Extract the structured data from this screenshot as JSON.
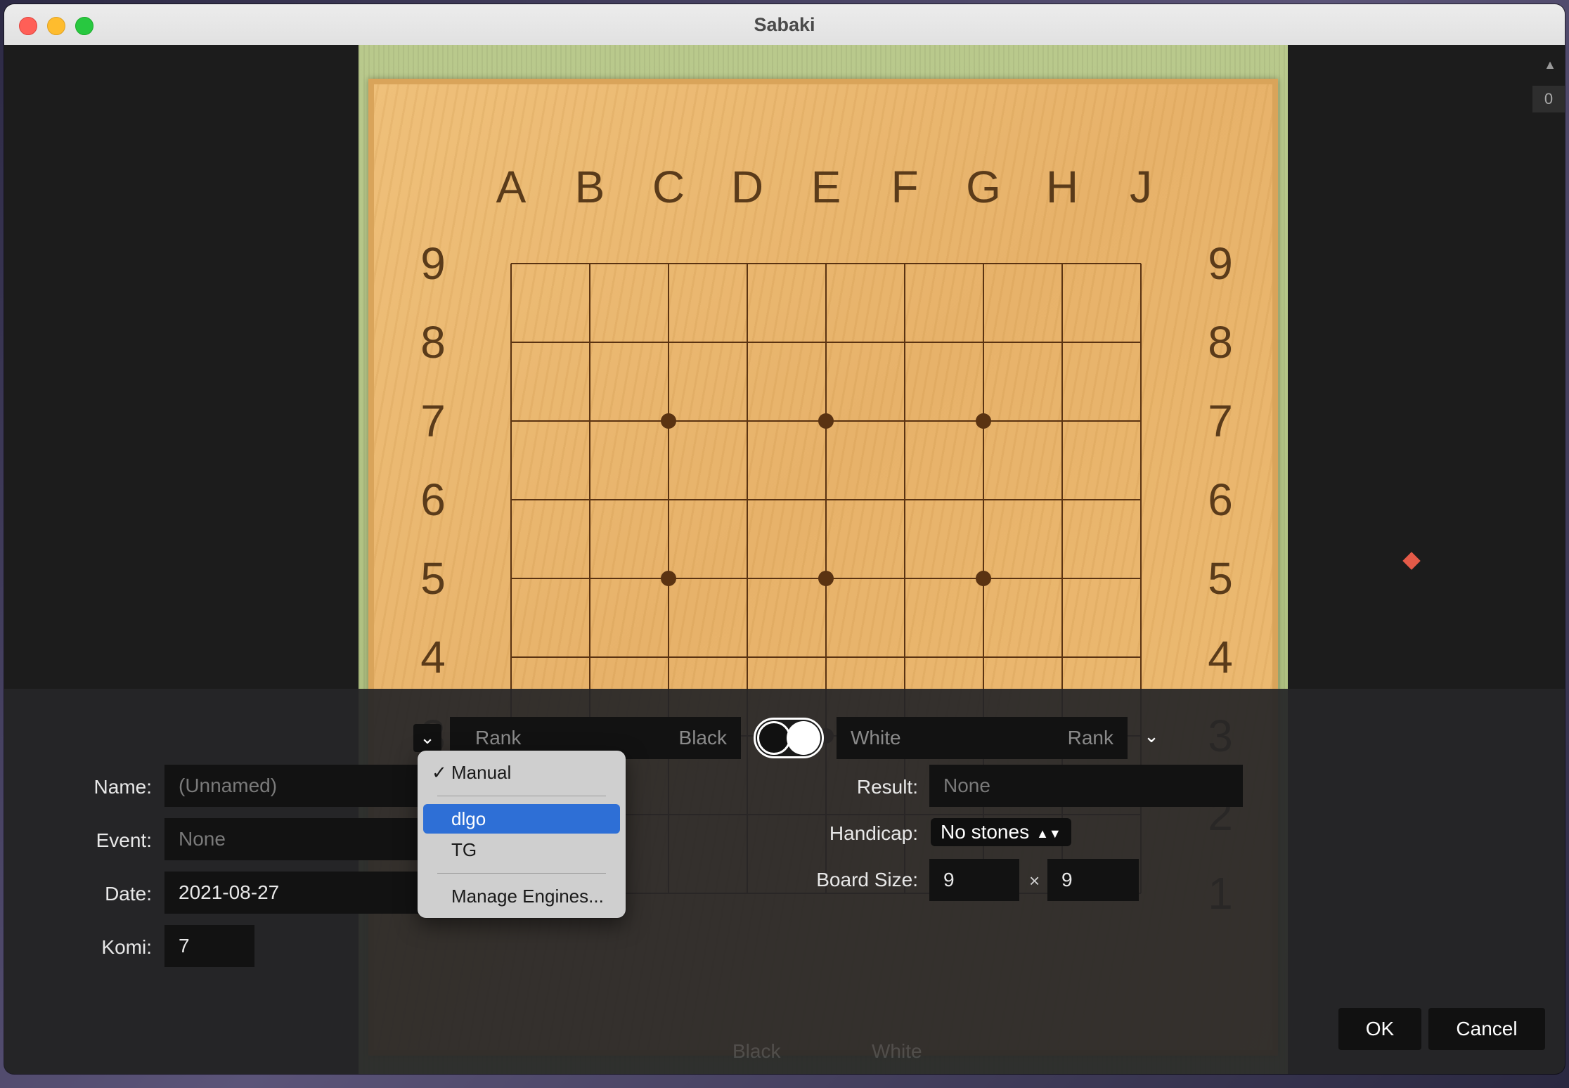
{
  "window": {
    "title": "Sabaki"
  },
  "board": {
    "columns": [
      "A",
      "B",
      "C",
      "D",
      "E",
      "F",
      "G",
      "H",
      "J"
    ],
    "rows": [
      "9",
      "8",
      "7",
      "6",
      "5",
      "4",
      "3",
      "2",
      "1"
    ],
    "size": 9,
    "star_points": [
      [
        "C",
        7
      ],
      [
        "E",
        7
      ],
      [
        "G",
        7
      ],
      [
        "C",
        5
      ],
      [
        "E",
        5
      ],
      [
        "G",
        5
      ],
      [
        "C",
        3
      ],
      [
        "E",
        3
      ],
      [
        "G",
        3
      ]
    ],
    "wood_color": "#e9b66f",
    "line_color": "#5a3312"
  },
  "sidebar": {
    "scroll_arrow": "▲",
    "counter": "0"
  },
  "players": {
    "black": {
      "rank_placeholder": "Rank",
      "name_placeholder": "Black"
    },
    "white": {
      "name_placeholder": "White",
      "rank_placeholder": "Rank"
    }
  },
  "info": {
    "name_label": "Name:",
    "name_placeholder": "(Unnamed)",
    "event_label": "Event:",
    "event_placeholder": "None",
    "date_label": "Date:",
    "date_value": "2021-08-27",
    "komi_label": "Komi:",
    "komi_value": "7",
    "result_label": "Result:",
    "result_placeholder": "None",
    "handicap_label": "Handicap:",
    "handicap_value": "No stones",
    "board_size_label": "Board Size:",
    "board_width": "9",
    "board_height": "9",
    "times_symbol": "×"
  },
  "buttons": {
    "ok": "OK",
    "cancel": "Cancel"
  },
  "engine_menu": {
    "checkmark": "✓",
    "items": [
      "Manual",
      "dlgo",
      "TG",
      "Manage Engines..."
    ],
    "checked": "Manual",
    "highlighted": "dlgo"
  },
  "colors": {
    "accent": "#2e6fd6",
    "marker": "#e45a48"
  },
  "background_bar": {
    "black": "Black",
    "white": "White"
  }
}
